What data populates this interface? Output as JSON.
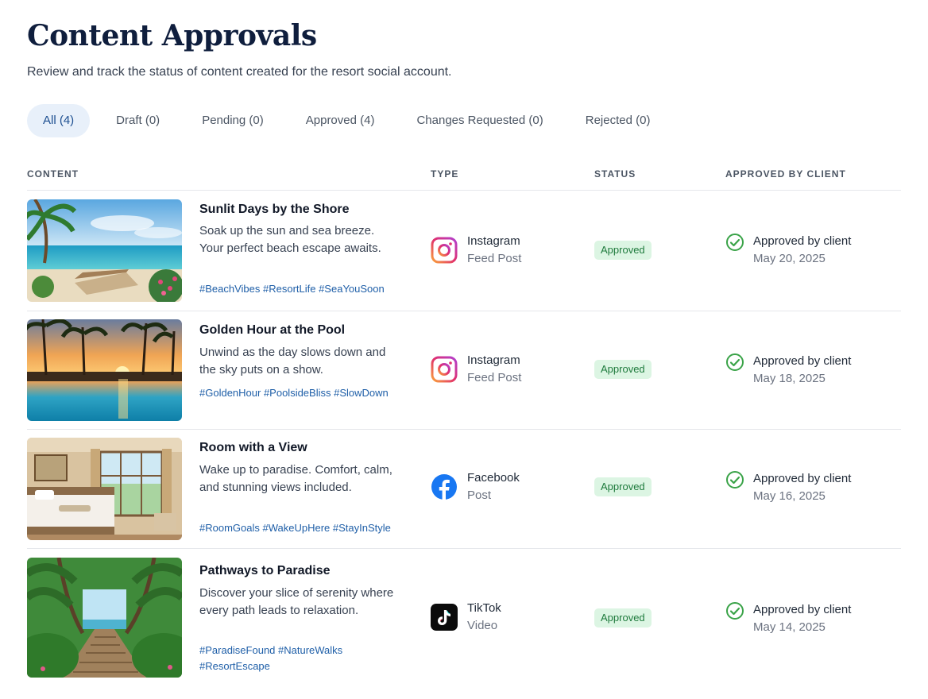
{
  "page": {
    "title": "Content Approvals",
    "subtitle": "Review and track the status of content created for the resort social account."
  },
  "tabs": [
    {
      "label": "All (4)",
      "active": true
    },
    {
      "label": "Draft (0)",
      "active": false
    },
    {
      "label": "Pending (0)",
      "active": false
    },
    {
      "label": "Approved (4)",
      "active": false
    },
    {
      "label": "Changes Requested (0)",
      "active": false
    },
    {
      "label": "Rejected (0)",
      "active": false
    }
  ],
  "columns": {
    "content": "CONTENT",
    "type": "TYPE",
    "status": "STATUS",
    "approved_by": "APPROVED BY CLIENT"
  },
  "rows": [
    {
      "title": "Sunlit Days by the Shore",
      "description": "Soak up the sun and sea breeze. Your perfect beach escape awaits.",
      "tags": "#BeachVibes #ResortLife #SeaYouSoon",
      "platform": "Instagram",
      "format": "Feed Post",
      "platform_icon": "instagram-icon",
      "status": "Approved",
      "approval_text": "Approved by client",
      "approval_date": "May 20, 2025"
    },
    {
      "title": "Golden Hour at the Pool",
      "description": "Unwind as the day slows down and the sky puts on a show.",
      "tags": "#GoldenHour #PoolsideBliss #SlowDown",
      "platform": "Instagram",
      "format": "Feed Post",
      "platform_icon": "instagram-icon",
      "status": "Approved",
      "approval_text": "Approved by client",
      "approval_date": "May 18, 2025"
    },
    {
      "title": "Room with a View",
      "description": "Wake up to paradise. Comfort, calm, and stunning views included.",
      "tags": "#RoomGoals #WakeUpHere #StayInStyle",
      "platform": "Facebook",
      "format": "Post",
      "platform_icon": "facebook-icon",
      "status": "Approved",
      "approval_text": "Approved by client",
      "approval_date": "May 16, 2025"
    },
    {
      "title": "Pathways to Paradise",
      "description": "Discover your slice of serenity where every path leads to relaxation.",
      "tags": "#ParadiseFound #NatureWalks #ResortEscape",
      "platform": "TikTok",
      "format": "Video",
      "platform_icon": "tiktok-icon",
      "status": "Approved",
      "approval_text": "Approved by client",
      "approval_date": "May 14, 2025"
    }
  ],
  "colors": {
    "accent": "#1d4f91",
    "tab_active_bg": "#e8f0fa",
    "badge_bg": "#dcf5e3",
    "badge_text": "#1e7a3c",
    "check_green": "#3aa348",
    "tag_link": "#1f5fa8"
  }
}
